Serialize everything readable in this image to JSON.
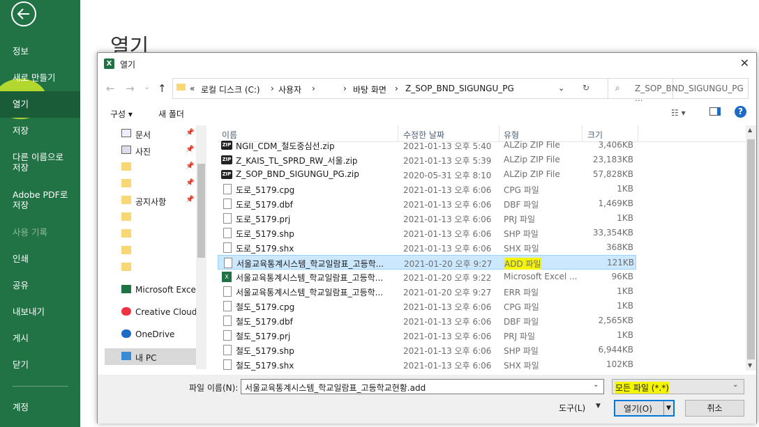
{
  "backstage": {
    "title": "열기",
    "menu": [
      {
        "label": "정보",
        "disabled": false
      },
      {
        "label": "새로 만들기",
        "disabled": false
      },
      {
        "label": "열기",
        "disabled": false,
        "selected": true
      },
      {
        "label": "저장",
        "disabled": false
      },
      {
        "label": "다른 이름으로 저장",
        "disabled": false
      },
      {
        "label": "Adobe PDF로 저장",
        "disabled": false
      },
      {
        "label": "사용 기록",
        "disabled": true
      },
      {
        "label": "인쇄",
        "disabled": false
      },
      {
        "label": "공유",
        "disabled": false
      },
      {
        "label": "내보내기",
        "disabled": false
      },
      {
        "label": "게시",
        "disabled": false
      },
      {
        "label": "닫기",
        "disabled": false
      }
    ],
    "bottom_item": "계정"
  },
  "dialog": {
    "title": "열기",
    "address": {
      "prefix": "«",
      "drive": "로컬 디스크 (C:)",
      "sep1": "›",
      "users": "사용자",
      "sep2": "›",
      "sep3": "›",
      "desktop": "바탕 화면",
      "sep4": "›",
      "folder": "Z_SOP_BND_SIGUNGU_PG"
    },
    "search_placeholder": "Z_SOP_BND_SIGUNGU_PG ...",
    "toolbar": {
      "organize": "구성 ▾",
      "new_folder": "새 폴더"
    },
    "nav_pane": [
      {
        "label": "문서",
        "icon": "document-icon",
        "pinned": true
      },
      {
        "label": "사진",
        "icon": "picture-icon",
        "pinned": true
      },
      {
        "label": "",
        "icon": "folder-icon",
        "pinned": true
      },
      {
        "label": "",
        "icon": "folder-icon",
        "pinned": true
      },
      {
        "label": "공지사항",
        "icon": "folder-icon",
        "pinned": true
      },
      {
        "label": "",
        "icon": "folder-icon",
        "pinned": false
      },
      {
        "label": "",
        "icon": "folder-icon",
        "pinned": false
      },
      {
        "label": "",
        "icon": "folder-icon",
        "pinned": false
      },
      {
        "label": "",
        "icon": "folder-icon",
        "pinned": false
      },
      {
        "label": "Microsoft Excel",
        "icon": "excel-icon",
        "pinned": false
      },
      {
        "label": "Creative Cloud Fil",
        "icon": "creative-cloud-icon",
        "pinned": false
      },
      {
        "label": "OneDrive",
        "icon": "onedrive-icon",
        "pinned": false
      },
      {
        "label": "내 PC",
        "icon": "pc-icon",
        "pinned": false,
        "selected": true
      }
    ],
    "columns": {
      "name": "이름",
      "date": "수정한 날짜",
      "type": "유형",
      "size": "크기"
    },
    "files": [
      {
        "name": "NGII_CDM_철도중심선.zip",
        "date": "2021-01-13 오후 5:40",
        "type": "ALZip ZIP File",
        "size": "3,406KB",
        "icon": "zip"
      },
      {
        "name": "Z_KAIS_TL_SPRD_RW_서울.zip",
        "date": "2021-01-13 오후 5:39",
        "type": "ALZip ZIP File",
        "size": "23,183KB",
        "icon": "zip"
      },
      {
        "name": "Z_SOP_BND_SIGUNGU_PG.zip",
        "date": "2020-05-31 오후 8:10",
        "type": "ALZip ZIP File",
        "size": "57,828KB",
        "icon": "zip"
      },
      {
        "name": "도로_5179.cpg",
        "date": "2021-01-13 오후 6:06",
        "type": "CPG 파일",
        "size": "1KB",
        "icon": "doc"
      },
      {
        "name": "도로_5179.dbf",
        "date": "2021-01-13 오후 6:06",
        "type": "DBF 파일",
        "size": "1,469KB",
        "icon": "doc"
      },
      {
        "name": "도로_5179.prj",
        "date": "2021-01-13 오후 6:06",
        "type": "PRJ 파일",
        "size": "1KB",
        "icon": "doc"
      },
      {
        "name": "도로_5179.shp",
        "date": "2021-01-13 오후 6:06",
        "type": "SHP 파일",
        "size": "33,354KB",
        "icon": "doc"
      },
      {
        "name": "도로_5179.shx",
        "date": "2021-01-13 오후 6:06",
        "type": "SHX 파일",
        "size": "368KB",
        "icon": "doc"
      },
      {
        "name": "서울교육통계시스템_학교일람표_고등학...",
        "date": "2021-01-20 오후 9:27",
        "type": "ADD 파일",
        "size": "121KB",
        "icon": "doc",
        "selected": true
      },
      {
        "name": "서울교육통계시스템_학교일람표_고등학...",
        "date": "2021-01-20 오후 9:22",
        "type": "Microsoft Excel ...",
        "size": "96KB",
        "icon": "xls"
      },
      {
        "name": "서울교육통계시스템_학교일람표_고등학...",
        "date": "2021-01-20 오후 9:27",
        "type": "ERR 파일",
        "size": "1KB",
        "icon": "doc"
      },
      {
        "name": "철도_5179.cpg",
        "date": "2021-01-13 오후 6:06",
        "type": "CPG 파일",
        "size": "1KB",
        "icon": "doc"
      },
      {
        "name": "철도_5179.dbf",
        "date": "2021-01-13 오후 6:06",
        "type": "DBF 파일",
        "size": "2,565KB",
        "icon": "doc"
      },
      {
        "name": "철도_5179.prj",
        "date": "2021-01-13 오후 6:06",
        "type": "PRJ 파일",
        "size": "1KB",
        "icon": "doc"
      },
      {
        "name": "철도_5179.shp",
        "date": "2021-01-13 오후 6:06",
        "type": "SHP 파일",
        "size": "6,944KB",
        "icon": "doc"
      },
      {
        "name": "철도_5179.shx",
        "date": "2021-01-13 오후 6:06",
        "type": "SHX 파일",
        "size": "102KB",
        "icon": "doc"
      }
    ],
    "footer": {
      "filename_label": "파일 이름(N):",
      "filename_value": "서울교육통계시스템_학교일람표_고등학교현황.add",
      "filetype_value": "모든 파일 (*.*)",
      "tools_label": "도구(L)",
      "open_label": "열기(O)",
      "cancel_label": "취소"
    }
  },
  "colors": {
    "accent": "#217346",
    "highlight": "#f5f500",
    "selection": "#cce8ff"
  }
}
